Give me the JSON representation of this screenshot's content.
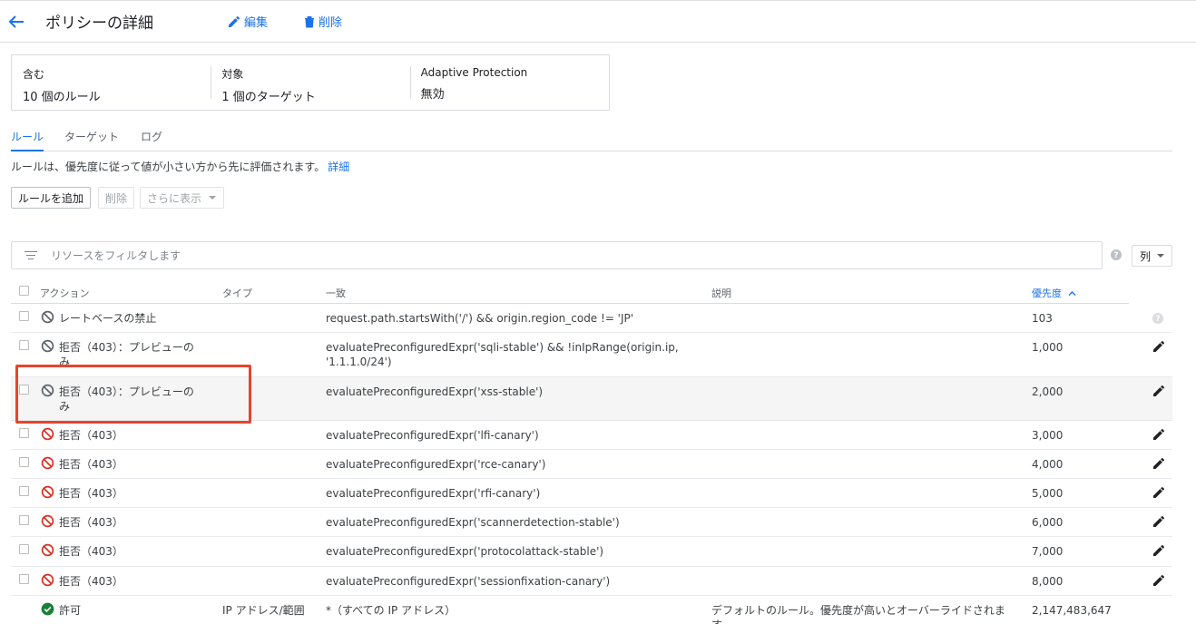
{
  "header": {
    "title": "ポリシーの詳細",
    "edit_label": "編集",
    "delete_label": "削除"
  },
  "summary": [
    {
      "label": "含む",
      "value": "10 個のルール"
    },
    {
      "label": "対象",
      "value": "1 個のターゲット"
    },
    {
      "label": "Adaptive Protection",
      "value": "無効"
    }
  ],
  "tabs": [
    {
      "label": "ルール",
      "active": true
    },
    {
      "label": "ターゲット",
      "active": false
    },
    {
      "label": "ログ",
      "active": false
    }
  ],
  "hint": {
    "text": "ルールは、優先度に従って値が小さい方から先に評価されます。",
    "link": "詳細"
  },
  "toolbar": {
    "add_rule": "ルールを追加",
    "delete": "削除",
    "more": "さらに表示"
  },
  "filter": {
    "placeholder": "リソースをフィルタします",
    "columns_label": "列"
  },
  "table": {
    "headers": {
      "action": "アクション",
      "type": "タイプ",
      "match": "一致",
      "description": "説明",
      "priority": "優先度"
    },
    "rows": [
      {
        "action": "レートベースの禁止",
        "icon": "block-gray-icon",
        "type": "",
        "match": "request.path.startsWith('/') && origin.region_code != 'JP'",
        "description": "",
        "priority": "103",
        "row_icon": "help-icon"
      },
      {
        "action": "拒否（403）：プレビューのみ",
        "icon": "block-gray-icon",
        "type": "",
        "match": "evaluatePreconfiguredExpr('sqli-stable') && !inIpRange(origin.ip, '1.1.1.0/24')",
        "description": "",
        "priority": "1,000",
        "row_icon": "edit-icon"
      },
      {
        "action": "拒否（403）：プレビューのみ",
        "icon": "block-gray-icon",
        "type": "",
        "match": "evaluatePreconfiguredExpr('xss-stable')",
        "description": "",
        "priority": "2,000",
        "row_icon": "edit-icon"
      },
      {
        "action": "拒否（403）",
        "icon": "block-red-icon",
        "type": "",
        "match": "evaluatePreconfiguredExpr('lfi-canary')",
        "description": "",
        "priority": "3,000",
        "row_icon": "edit-icon"
      },
      {
        "action": "拒否（403）",
        "icon": "block-red-icon",
        "type": "",
        "match": "evaluatePreconfiguredExpr('rce-canary')",
        "description": "",
        "priority": "4,000",
        "row_icon": "edit-icon"
      },
      {
        "action": "拒否（403）",
        "icon": "block-red-icon",
        "type": "",
        "match": "evaluatePreconfiguredExpr('rfi-canary')",
        "description": "",
        "priority": "5,000",
        "row_icon": "edit-icon"
      },
      {
        "action": "拒否（403）",
        "icon": "block-red-icon",
        "type": "",
        "match": "evaluatePreconfiguredExpr('scannerdetection-stable')",
        "description": "",
        "priority": "6,000",
        "row_icon": "edit-icon"
      },
      {
        "action": "拒否（403）",
        "icon": "block-red-icon",
        "type": "",
        "match": "evaluatePreconfiguredExpr('protocolattack-stable')",
        "description": "",
        "priority": "7,000",
        "row_icon": "edit-icon"
      },
      {
        "action": "拒否（403）",
        "icon": "block-red-icon",
        "type": "",
        "match": "evaluatePreconfiguredExpr('sessionfixation-canary')",
        "description": "",
        "priority": "8,000",
        "row_icon": "edit-icon"
      },
      {
        "action": "許可",
        "icon": "check-circle-icon",
        "type": "IP アドレス/範囲",
        "match": "*（すべての IP アドレス）",
        "description": "デフォルトのルール。優先度が高いとオーバーライドされます。",
        "priority": "2,147,483,647",
        "row_icon": ""
      }
    ]
  },
  "colors": {
    "accent": "#1a73e8",
    "deny": "#d93025",
    "preview": "#5f6368",
    "allow": "#188038",
    "callout": "#e8432d"
  }
}
